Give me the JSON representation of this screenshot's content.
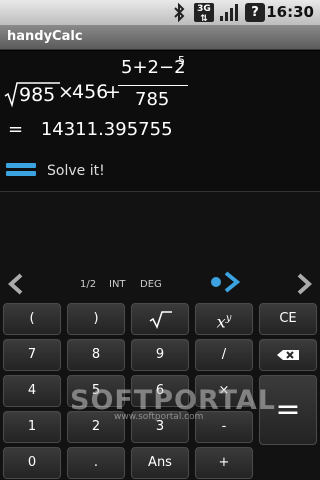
{
  "status_bar": {
    "time": "16:30",
    "network_label": "3G",
    "icons": [
      "bluetooth-icon",
      "3g-icon",
      "signal-icon",
      "unknown-icon"
    ],
    "unknown_glyph": "?"
  },
  "app": {
    "title": "handyCalc"
  },
  "display": {
    "expression": {
      "sqrt_arg": "985",
      "times": "×",
      "operand": "456",
      "plus": "+",
      "frac_top": "5+2−2",
      "frac_exp": "5",
      "frac_bottom": "785"
    },
    "result": {
      "eq": "=",
      "value": "14311.395755"
    },
    "solve_label": "Solve it!"
  },
  "modes": {
    "fraction": "1/2",
    "int": "INT",
    "angle": "DEG"
  },
  "keys": {
    "open_paren": "(",
    "close_paren": ")",
    "power_base": "x",
    "power_exp": "y",
    "ce": "CE",
    "seven": "7",
    "eight": "8",
    "nine": "9",
    "divide": "/",
    "four": "4",
    "five": "5",
    "six": "6",
    "multiply": "×",
    "one": "1",
    "two": "2",
    "three": "3",
    "minus": "-",
    "zero": "0",
    "dot": ".",
    "ans": "Ans",
    "plus": "+",
    "equals": "="
  },
  "watermark": {
    "text": "SOFTPORTAL",
    "url": "www.softportal.com"
  },
  "colors": {
    "accent": "#3ba3e0",
    "background": "#000000",
    "key_bg": "#2e2e2e"
  }
}
